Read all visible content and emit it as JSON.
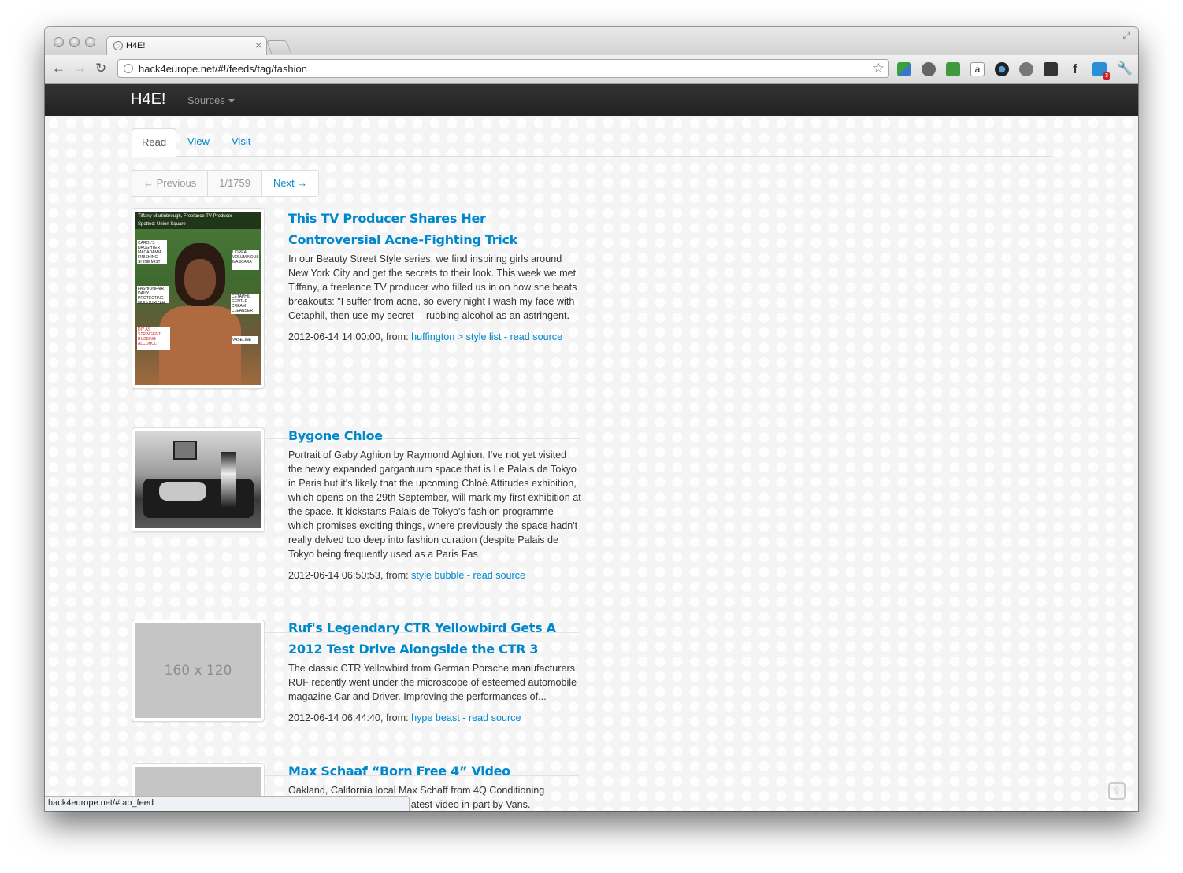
{
  "browser": {
    "tab_title": "H4E!",
    "url": "hack4europe.net/#!/feeds/tag/fashion",
    "status_url": "hack4europe.net/#tab_feed",
    "extension_badge": "3"
  },
  "navbar": {
    "brand": "H4E!",
    "sources_label": "Sources"
  },
  "tabs": [
    {
      "label": "Read",
      "active": true
    },
    {
      "label": "View",
      "active": false
    },
    {
      "label": "Visit",
      "active": false
    }
  ],
  "pager": {
    "previous": "← Previous",
    "count": "1/1759",
    "next": "Next →"
  },
  "items": [
    {
      "title": "This TV Producer Shares Her Controversial Acne-Fighting Trick",
      "text": "In our Beauty Street Style series, we find inspiring girls around New York City and get the secrets to their look. This week we met Tiffany, a freelance TV producer who filled us in on how she beats breakouts: \"I suffer from acne, so every night I wash my face with Cetaphil, then use my secret -- rubbing alcohol as an astringent.",
      "date": "2012-06-14 14:00:00, from: ",
      "source": "huffington > style list",
      "separator": " - ",
      "read_source": "read source",
      "image_caption": "Tiffany Martinbrough, Freelance TV Producer",
      "image_caption2": "Spotted: Union Square",
      "image_labels": [
        "CAROL'S DAUGHTER MACADAMIA FINISHING SHINE MIST",
        "L'OREAL VOLUMINOUS MASCARA",
        "FASHIONFAIR DAILY PROTECTING MOISTURIZER",
        "CETAPHIL GENTLE CREAM CLEANSER",
        "DIY AS STRINGENT: RUBBING ALCOHOL",
        "VASELINE"
      ]
    },
    {
      "title": "Bygone Chloe",
      "text": "Portrait of Gaby Aghion by Raymond Aghion. I've not yet visited the newly expanded gargantuum space that is Le Palais de Tokyo in Paris but it's likely that the upcoming Chloé.Attitudes exhibition, which opens on the 29th September, will mark my first exhibition at the space. It kickstarts Palais de Tokyo's fashion programme which promises exciting things, where previously the space hadn't really delved too deep into fashion curation (despite Palais de Tokyo being frequently used as a Paris Fas",
      "date": "2012-06-14 06:50:53, from: ",
      "source": "style bubble",
      "separator": " - ",
      "read_source": "read source"
    },
    {
      "title": "Ruf's Legendary CTR Yellowbird Gets A 2012 Test Drive Alongside the CTR 3",
      "text": "The classic CTR Yellowbird from German Porsche manufacturers RUF recently went under the microscope of esteemed automobile magazine Car and Driver. Improving the performances of...",
      "date": "2012-06-14 06:44:40, from: ",
      "source": "hype beast",
      "separator": " - ",
      "read_source": "read source",
      "placeholder": "160 x 120"
    },
    {
      "title": "Max Schaaf “Born Free 4” Video",
      "text": "Oakland, California local Max Schaff from 4Q Conditioning",
      "text2": "latest video in-part by Vans."
    }
  ]
}
